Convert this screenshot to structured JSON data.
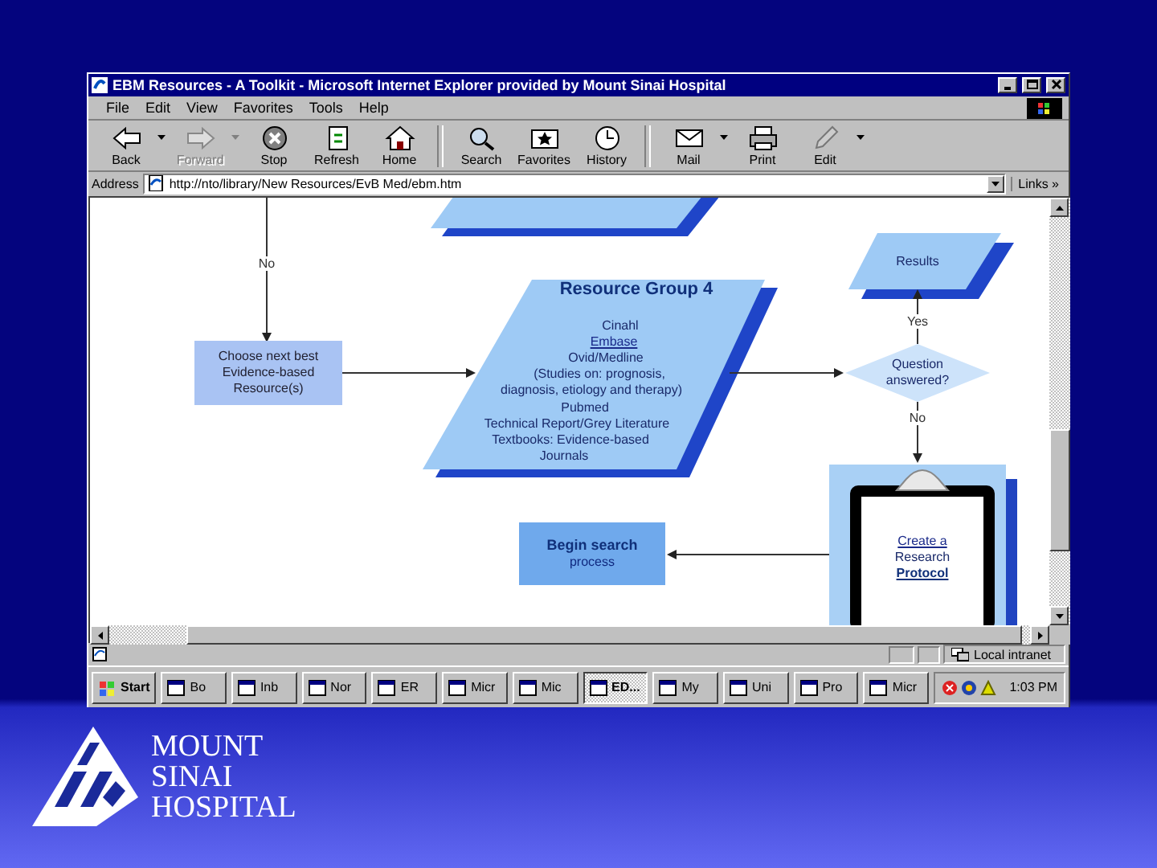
{
  "window": {
    "title": "EBM Resources - A Toolkit - Microsoft Internet Explorer provided by Mount Sinai Hospital"
  },
  "menu": [
    "File",
    "Edit",
    "View",
    "Favorites",
    "Tools",
    "Help"
  ],
  "toolbar": [
    {
      "label": "Back",
      "disabled": false
    },
    {
      "label": "Forward",
      "disabled": true
    },
    {
      "label": "Stop",
      "disabled": false
    },
    {
      "label": "Refresh",
      "disabled": false
    },
    {
      "label": "Home",
      "disabled": false
    },
    {
      "label": "Search",
      "disabled": false
    },
    {
      "label": "Favorites",
      "disabled": false
    },
    {
      "label": "History",
      "disabled": false
    },
    {
      "label": "Mail",
      "disabled": false
    },
    {
      "label": "Print",
      "disabled": false
    },
    {
      "label": "Edit",
      "disabled": false
    }
  ],
  "address": {
    "label": "Address",
    "value": "http://nto/library/New Resources/EvB Med/ebm.htm",
    "links": "Links »"
  },
  "flowchart": {
    "nodes": [
      {
        "kind": "data"
      },
      {
        "kind": "data",
        "lines": [
          {
            "kind": "text",
            "text": "Results"
          }
        ]
      },
      {
        "kind": "process",
        "lines": [
          {
            "kind": "text",
            "text": "Choose next best"
          },
          {
            "kind": "text",
            "text": "Evidence-based"
          },
          {
            "kind": "text",
            "text": "Resource(s)"
          }
        ]
      },
      {
        "kind": "data",
        "lines": [
          {
            "kind": "heading",
            "text": "Resource Group 4"
          },
          {
            "kind": "text",
            "text": "Cinahl"
          },
          {
            "kind": "link",
            "text": "Embase"
          },
          {
            "kind": "text",
            "text": "Ovid/Medline"
          },
          {
            "kind": "text",
            "text": "(Studies on: prognosis,"
          },
          {
            "kind": "text",
            "text": "diagnosis, etiology and therapy)"
          },
          {
            "kind": "text",
            "text": "Pubmed"
          },
          {
            "kind": "text",
            "text": "Technical Report/Grey Literature"
          },
          {
            "kind": "text",
            "text": "Textbooks: Evidence-based"
          },
          {
            "kind": "text",
            "text": "Journals"
          }
        ]
      },
      {
        "kind": "decision",
        "lines": [
          {
            "kind": "text",
            "text": "Question"
          },
          {
            "kind": "text",
            "text": "answered?"
          }
        ]
      },
      {
        "kind": "start",
        "lines": [
          {
            "kind": "heading",
            "text": "Begin search"
          },
          {
            "kind": "text",
            "text": "process"
          }
        ]
      },
      {
        "kind": "document",
        "lines": [
          {
            "kind": "link",
            "text": "Create a"
          },
          {
            "kind": "text",
            "text": "Research"
          },
          {
            "kind": "strong-link",
            "text": "Protocol"
          }
        ]
      }
    ],
    "connector_labels": [
      "No",
      "Yes",
      "No"
    ]
  },
  "status_bar": {
    "zone": "Local intranet"
  },
  "taskbar": {
    "start": "Start",
    "buttons": [
      {
        "label": "Bo",
        "selected": false
      },
      {
        "label": "Inb",
        "selected": false
      },
      {
        "label": "Nor",
        "selected": false
      },
      {
        "label": "ER",
        "selected": false
      },
      {
        "label": "Micr",
        "selected": false
      },
      {
        "label": "Mic",
        "selected": false
      },
      {
        "label": "ED...",
        "selected": true
      },
      {
        "label": "My",
        "selected": false
      },
      {
        "label": "Uni",
        "selected": false
      },
      {
        "label": "Pro",
        "selected": false
      },
      {
        "label": "Micr",
        "selected": false
      }
    ],
    "clock": "1:03 PM"
  },
  "logo": {
    "lines": [
      "MOUNT",
      "SINAI",
      "HOSPITAL"
    ]
  }
}
